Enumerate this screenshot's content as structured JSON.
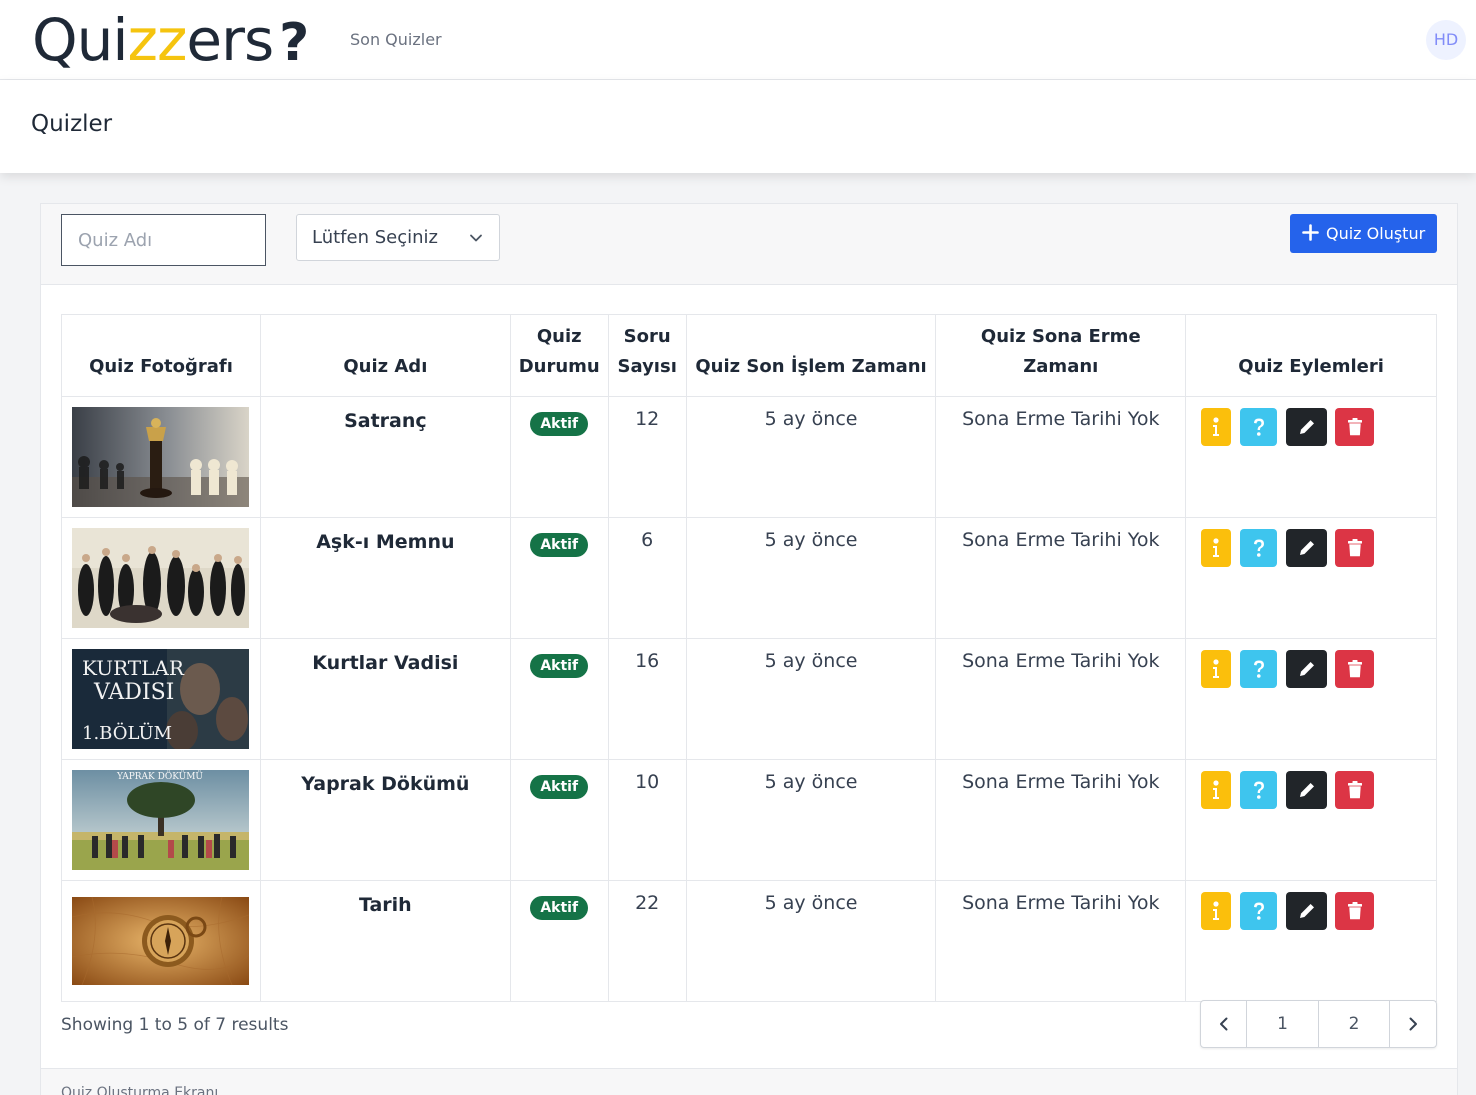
{
  "nav": {
    "logo": {
      "prefix": "Qui",
      "highlight": "zz",
      "suffix": "ers",
      "mark": "?"
    },
    "link": "Son Quizler",
    "avatar": "HD"
  },
  "page": {
    "title": "Quizler"
  },
  "toolbar": {
    "search_placeholder": "Quiz Adı",
    "select_value": "Lütfen Seçiniz",
    "create_label": "Quiz Oluştur"
  },
  "table": {
    "headers": [
      "Quiz Fotoğrafı",
      "Quiz Adı",
      "Quiz Durumu",
      "Soru Sayısı",
      "Quiz Son İşlem Zamanı",
      "Quiz Sona Erme Zamanı",
      "Quiz Eylemleri"
    ],
    "rows": [
      {
        "name": "Satranç",
        "status": "Aktif",
        "count": "12",
        "updated": "5 ay önce",
        "expiry": "Sona Erme Tarihi Yok"
      },
      {
        "name": "Aşk-ı Memnu",
        "status": "Aktif",
        "count": "6",
        "updated": "5 ay önce",
        "expiry": "Sona Erme Tarihi Yok"
      },
      {
        "name": "Kurtlar Vadisi",
        "status": "Aktif",
        "count": "16",
        "updated": "5 ay önce",
        "expiry": "Sona Erme Tarihi Yok",
        "image_text": [
          "KURTLAR",
          "VADISI",
          "1.BÖLÜM"
        ]
      },
      {
        "name": "Yaprak Dökümü",
        "status": "Aktif",
        "count": "10",
        "updated": "5 ay önce",
        "expiry": "Sona Erme Tarihi Yok",
        "image_text": [
          "YAPRAK DÖKÜMÜ"
        ]
      },
      {
        "name": "Tarih",
        "status": "Aktif",
        "count": "22",
        "updated": "5 ay önce",
        "expiry": "Sona Erme Tarihi Yok"
      }
    ]
  },
  "pagination": {
    "summary": "Showing 1 to 5 of 7 results",
    "pages": [
      "1",
      "2"
    ]
  },
  "footer": {
    "text": "Quiz Oluşturma Ekranı"
  },
  "colors": {
    "brand_yellow": "#f5c40f",
    "primary": "#2563eb",
    "success": "#157347",
    "info": "#fbbf0c",
    "question": "#3ec5ee",
    "dark": "#212529",
    "danger": "#dc3545"
  }
}
